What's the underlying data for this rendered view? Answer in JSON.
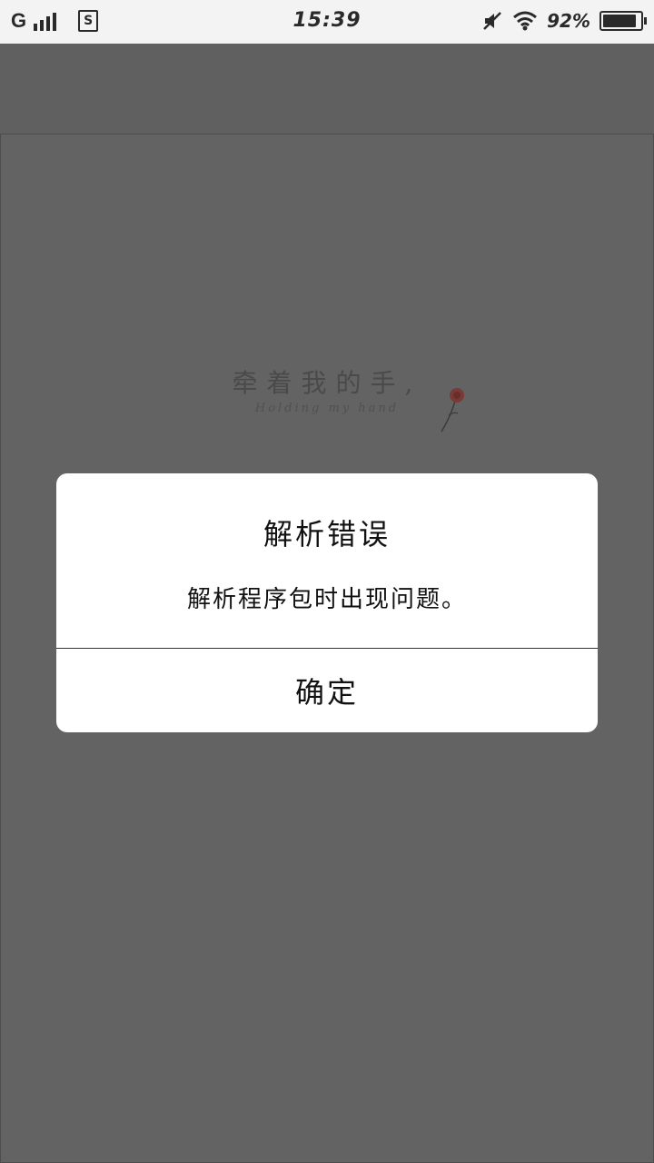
{
  "status_bar": {
    "network": "G",
    "time": "15:39",
    "battery_percent": "92%",
    "battery_level": 0.92,
    "icons": [
      "signal-icon",
      "sim-icon",
      "mute-icon",
      "wifi-icon",
      "battery-icon"
    ]
  },
  "background_page": {
    "title": "牵着我的手,",
    "subtitle": "Holding my hand"
  },
  "dialog": {
    "title": "解析错误",
    "message": "解析程序包时出现问题。",
    "ok_label": "确定"
  }
}
